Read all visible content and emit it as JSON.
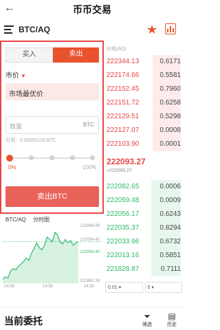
{
  "header": {
    "back_glyph": "←",
    "title": "币币交易"
  },
  "pair_bar": {
    "pair": "BTC/AQ",
    "menu_icon": "menu-icon",
    "favorite_icon": "star-icon",
    "chart_icon": "chart-icon"
  },
  "order_form": {
    "tabs": [
      {
        "label": "买入",
        "active": false
      },
      {
        "label": "卖出",
        "active": true
      }
    ],
    "price_label": "市价",
    "price_mode": "市场最优价",
    "quantity_placeholder": "数量",
    "quantity_unit": "BTC",
    "available": "可用：0.00005120 BTC",
    "slider_value_percent": 0,
    "percent_min": "0%",
    "percent_max": "100%",
    "submit_label": "卖出BTC"
  },
  "order_book": {
    "header": "价格(AQ)",
    "asks": [
      {
        "price": "222344.13",
        "qty": "0.6171"
      },
      {
        "price": "222174.66",
        "qty": "0.5581"
      },
      {
        "price": "222152.45",
        "qty": "0.7960"
      },
      {
        "price": "222151.72",
        "qty": "0.6258"
      },
      {
        "price": "222129.51",
        "qty": "0.5298"
      },
      {
        "price": "222127.07",
        "qty": "0.0008"
      },
      {
        "price": "222103.90",
        "qty": "0.0001"
      }
    ],
    "last_price": "222093.27",
    "last_price_sub": "≈222093.27",
    "bids": [
      {
        "price": "222082.65",
        "qty": "0.0006"
      },
      {
        "price": "222059.48",
        "qty": "0.0009"
      },
      {
        "price": "222056.17",
        "qty": "0.6243"
      },
      {
        "price": "222035.37",
        "qty": "0.8294"
      },
      {
        "price": "222033.96",
        "qty": "0.6732"
      },
      {
        "price": "222013.16",
        "qty": "0.5851"
      },
      {
        "price": "221828.87",
        "qty": "0.7111"
      }
    ],
    "precision": "0.01",
    "depth": "0"
  },
  "mini_chart": {
    "pair": "BTC/AQ",
    "interval": "分时图",
    "y_labels": [
      "222894.89",
      "222094.42",
      "222004.40",
      "222881.38"
    ],
    "current": "222004.40",
    "times": [
      "14:59",
      "14:59",
      "14:59"
    ]
  },
  "chart_data": {
    "type": "area",
    "title": "",
    "xlabel": "",
    "ylabel": "",
    "series": [
      {
        "values": [
          8,
          12,
          10,
          22,
          26,
          24,
          30,
          34,
          38,
          44,
          40,
          52,
          60,
          70,
          62,
          58,
          66,
          80,
          76,
          72,
          88,
          84,
          72,
          68,
          76,
          70,
          74,
          66,
          70,
          72
        ]
      }
    ]
  },
  "footer": {
    "heading": "当前委托",
    "filter_label": "筛选",
    "history_label": "历史",
    "filter_icon": "filter-icon",
    "history_icon": "history-icon"
  },
  "colors": {
    "accent": "#e8532d",
    "ask": "#e94545",
    "bid": "#2dba6a"
  }
}
